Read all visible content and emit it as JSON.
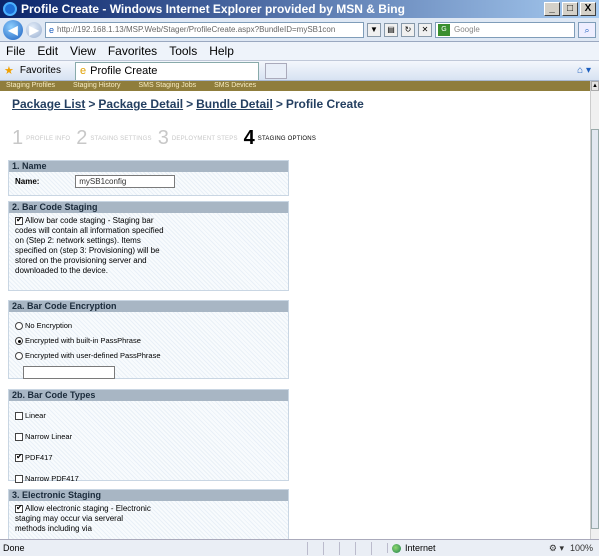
{
  "window": {
    "title": "Profile Create - Windows Internet Explorer provided by MSN & Bing",
    "buttons": [
      "_",
      "□",
      "X"
    ]
  },
  "address": {
    "url": "http://192.168.1.13/MSP.Web/Stager/ProfileCreate.aspx?BundleID=mySB1con",
    "search_placeholder": "Google"
  },
  "menu": [
    "File",
    "Edit",
    "View",
    "Favorites",
    "Tools",
    "Help"
  ],
  "favbar": {
    "favorites_label": "Favorites",
    "tab_title": "Profile Create"
  },
  "navstrip": [
    "Staging Profiles",
    "Staging History",
    "SMS Staging Jobs",
    "SMS Devices"
  ],
  "breadcrumb": {
    "items": [
      "Package List",
      "Package Detail",
      "Bundle Detail"
    ],
    "current": "Profile Create",
    "separator": ">"
  },
  "steps": [
    {
      "num": "1",
      "label": "PROFILE INFO",
      "active": false
    },
    {
      "num": "2",
      "label": "STAGING SETTINGS",
      "active": false
    },
    {
      "num": "3",
      "label": "DEPLOYMENT STEPS",
      "active": false
    },
    {
      "num": "4",
      "label": "STAGING OPTIONS",
      "active": true
    }
  ],
  "sections": {
    "name": {
      "heading": "1. Name",
      "label": "Name:",
      "value": "mySB1config"
    },
    "barcode_staging": {
      "heading": "2. Bar Code Staging",
      "checkbox_text": "Allow bar code staging - Staging bar codes will contain all information specified on (Step 2: network settings). Items specified on (step 3: Provisioning) will be stored on the provisioning server and downloaded to the device.",
      "checked": true
    },
    "barcode_encryption": {
      "heading": "2a. Bar Code Encryption",
      "options": [
        "No Encryption",
        "Encrypted with built-in PassPhrase",
        "Encrypted with user-defined PassPhrase"
      ],
      "selected_index": 1,
      "passphrase_value": ""
    },
    "barcode_types": {
      "heading": "2b. Bar Code Types",
      "options": [
        {
          "label": "Linear",
          "checked": false
        },
        {
          "label": "Narrow Linear",
          "checked": false
        },
        {
          "label": "PDF417",
          "checked": true
        },
        {
          "label": "Narrow PDF417",
          "checked": false
        }
      ]
    },
    "electronic_staging": {
      "heading": "3. Electronic Staging",
      "checkbox_text": "Allow electronic staging - Electronic staging may occur via serveral methods including via",
      "checked": true
    }
  },
  "status": {
    "text": "Done",
    "zone": "Internet",
    "zoom": "100%"
  }
}
